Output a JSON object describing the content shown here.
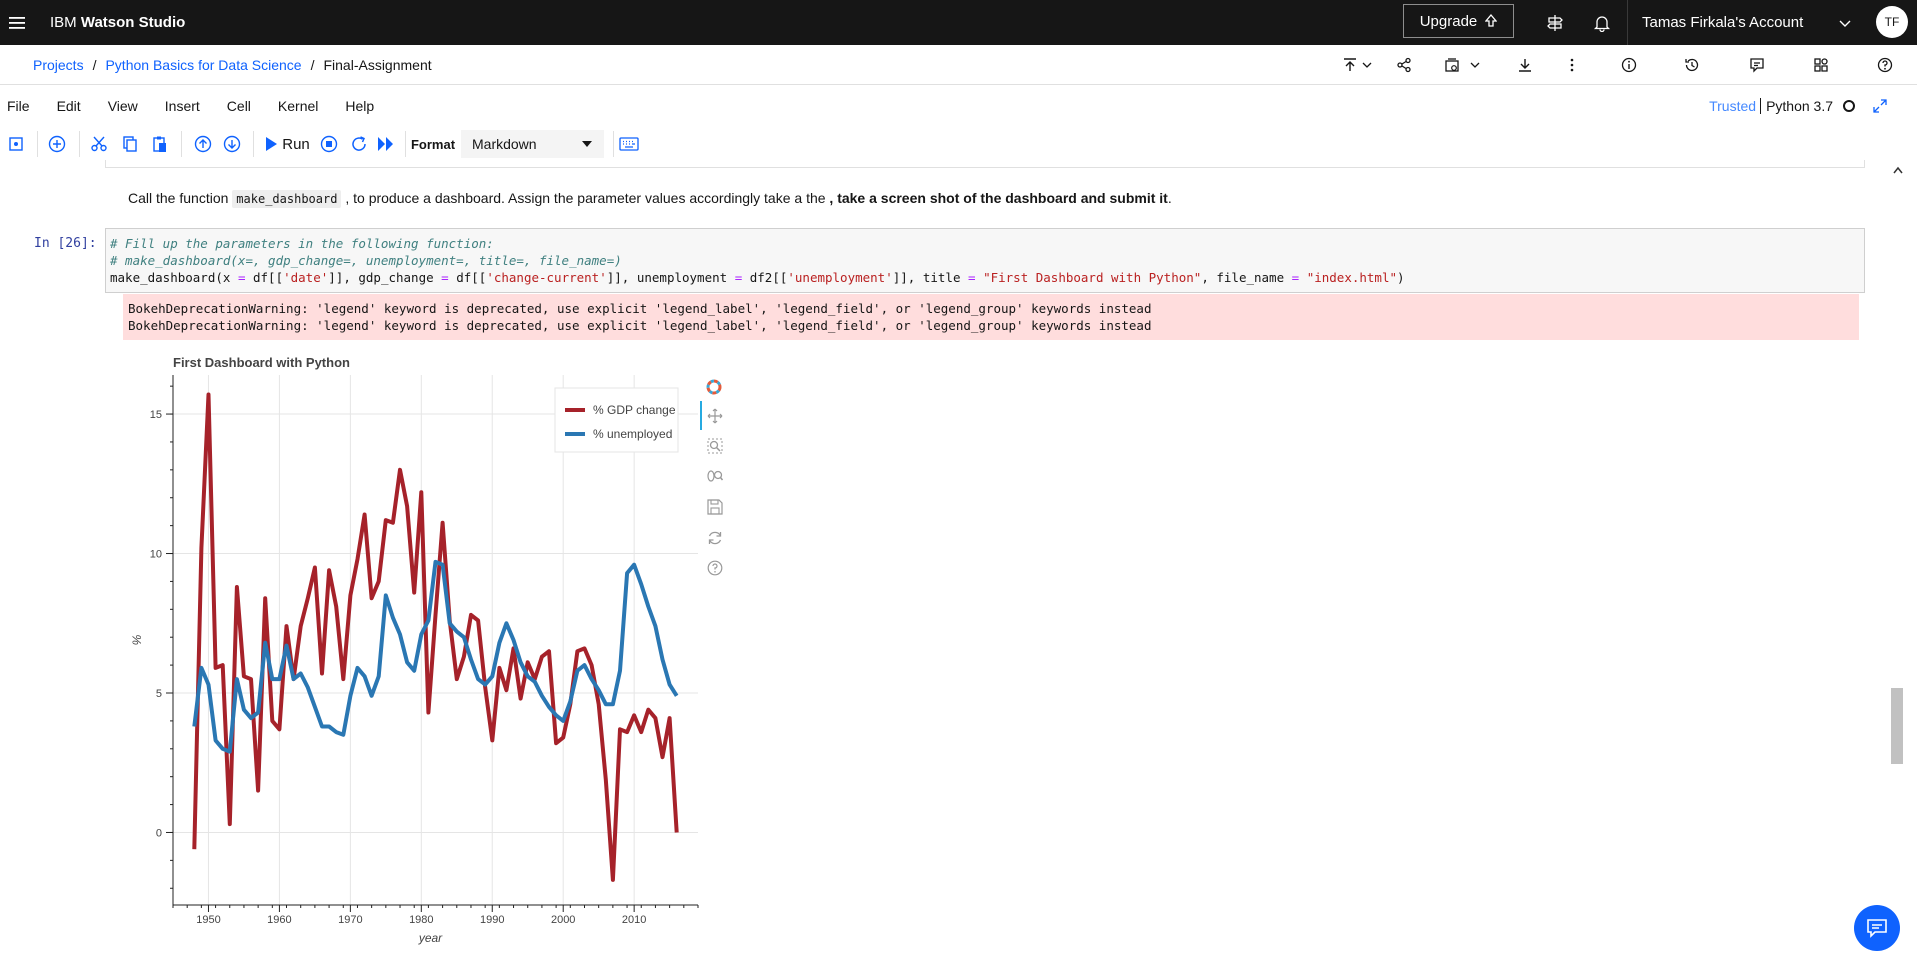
{
  "topbar": {
    "brand_prefix": "IBM",
    "brand_name": "Watson Studio",
    "upgrade_label": "Upgrade",
    "account_label": "Tamas Firkala's Account",
    "avatar_initials": "TF"
  },
  "breadcrumb": {
    "items": [
      "Projects",
      "Python Basics for Data Science",
      "Final-Assignment"
    ]
  },
  "menu": {
    "items": [
      "File",
      "Edit",
      "View",
      "Insert",
      "Cell",
      "Kernel",
      "Help"
    ],
    "trusted": "Trusted",
    "kernel": "Python 3.7"
  },
  "toolbar": {
    "run_label": "Run",
    "format_label": "Format",
    "format_value": "Markdown"
  },
  "notebook": {
    "markdown": {
      "before": "Call the function ",
      "code": "make_dashboard",
      "middle": " , to produce a dashboard. Assign the parameter values accordingly take a the ",
      "bold": ", take a screen shot of the dashboard and submit it",
      "after": "."
    },
    "prompt": "In [26]:",
    "code_line1": "# Fill up the parameters in the following function:",
    "code_line2": "# make_dashboard(x=, gdp_change=, unemployment=, title=, file_name=)",
    "code_line3": {
      "p1": "make_dashboard(x ",
      "eq1": "=",
      "p2": " df[[",
      "s1": "'date'",
      "p3": "]], gdp_change ",
      "eq2": "=",
      "p4": " df[[",
      "s2": "'change-current'",
      "p5": "]], unemployment ",
      "eq3": "=",
      "p6": " df2[[",
      "s3": "'unemployment'",
      "p7": "]], title ",
      "eq4": "=",
      "p8": " ",
      "s4": "\"First Dashboard with Python\"",
      "p9": ", file_name ",
      "eq5": "=",
      "p10": " ",
      "s5": "\"index.html\"",
      "p11": ")"
    },
    "stderr_lines": [
      "BokehDeprecationWarning: 'legend' keyword is deprecated, use explicit 'legend_label', 'legend_field', or 'legend_group' keywords instead",
      "BokehDeprecationWarning: 'legend' keyword is deprecated, use explicit 'legend_label', 'legend_field', or 'legend_group' keywords instead"
    ]
  },
  "colors": {
    "gdp": "#a6222a",
    "unemployed": "#2a77b3",
    "accent": "#0f62fe"
  },
  "chart_data": {
    "type": "line",
    "title": "First Dashboard with Python",
    "xlabel": "year",
    "ylabel": "%",
    "xlim": [
      1945,
      2019
    ],
    "ylim": [
      -2.6,
      16.4
    ],
    "x_ticks": [
      1950,
      1960,
      1970,
      1980,
      1990,
      2000,
      2010
    ],
    "y_ticks": [
      0,
      5,
      10,
      15
    ],
    "grid": true,
    "legend_position": "top-right",
    "series": [
      {
        "name": "% GDP change",
        "x": [
          1948,
          1949,
          1950,
          1951,
          1952,
          1953,
          1954,
          1955,
          1956,
          1957,
          1958,
          1959,
          1960,
          1961,
          1962,
          1963,
          1964,
          1965,
          1966,
          1967,
          1968,
          1969,
          1970,
          1971,
          1972,
          1973,
          1974,
          1975,
          1976,
          1977,
          1978,
          1979,
          1980,
          1981,
          1982,
          1983,
          1984,
          1985,
          1986,
          1987,
          1988,
          1989,
          1990,
          1991,
          1992,
          1993,
          1994,
          1995,
          1996,
          1997,
          1998,
          1999,
          2000,
          2001,
          2002,
          2003,
          2004,
          2005,
          2006,
          2007,
          2008,
          2009,
          2010,
          2011,
          2012,
          2013,
          2014,
          2015,
          2016
        ],
        "values": [
          -0.6,
          10.2,
          15.7,
          5.9,
          6.0,
          0.3,
          8.8,
          5.6,
          5.5,
          1.5,
          8.4,
          4.0,
          3.7,
          7.4,
          5.5,
          7.4,
          8.4,
          9.5,
          5.7,
          9.4,
          8.1,
          5.5,
          8.5,
          9.8,
          11.4,
          8.4,
          9.0,
          11.2,
          11.1,
          13.0,
          11.7,
          8.6,
          12.2,
          4.3,
          7.8,
          11.1,
          7.6,
          5.5,
          6.3,
          7.8,
          7.6,
          5.2,
          3.3,
          5.9,
          5.1,
          6.6,
          4.8,
          6.1,
          5.5,
          6.3,
          6.5,
          3.2,
          3.4,
          4.6,
          6.5,
          6.6,
          6.0,
          4.6,
          1.9,
          -1.7,
          3.7,
          3.6,
          4.2,
          3.6,
          4.4,
          4.1,
          2.7,
          4.1,
          0
        ]
      },
      {
        "name": "% unemployed",
        "x": [
          1948,
          1949,
          1950,
          1951,
          1952,
          1953,
          1954,
          1955,
          1956,
          1957,
          1958,
          1959,
          1960,
          1961,
          1962,
          1963,
          1964,
          1965,
          1966,
          1967,
          1968,
          1969,
          1970,
          1971,
          1972,
          1973,
          1974,
          1975,
          1976,
          1977,
          1978,
          1979,
          1980,
          1981,
          1982,
          1983,
          1984,
          1985,
          1986,
          1987,
          1988,
          1989,
          1990,
          1991,
          1992,
          1993,
          1994,
          1995,
          1996,
          1997,
          1998,
          1999,
          2000,
          2001,
          2002,
          2003,
          2004,
          2005,
          2006,
          2007,
          2008,
          2009,
          2010,
          2011,
          2012,
          2013,
          2014,
          2015,
          2016
        ],
        "values": [
          3.8,
          5.9,
          5.3,
          3.3,
          3.0,
          2.9,
          5.5,
          4.4,
          4.1,
          4.3,
          6.8,
          5.5,
          5.5,
          6.7,
          5.5,
          5.7,
          5.2,
          4.5,
          3.8,
          3.8,
          3.6,
          3.5,
          4.9,
          5.9,
          5.6,
          4.9,
          5.6,
          8.5,
          7.7,
          7.1,
          6.1,
          5.8,
          7.1,
          7.6,
          9.7,
          9.6,
          7.5,
          7.2,
          7.0,
          6.2,
          5.5,
          5.3,
          5.6,
          6.8,
          7.5,
          6.9,
          6.1,
          5.6,
          5.4,
          4.9,
          4.5,
          4.2,
          4.0,
          4.7,
          5.8,
          6.0,
          5.5,
          5.1,
          4.6,
          4.6,
          5.8,
          9.3,
          9.6,
          8.9,
          8.1,
          7.4,
          6.2,
          5.3,
          4.9
        ]
      }
    ]
  }
}
